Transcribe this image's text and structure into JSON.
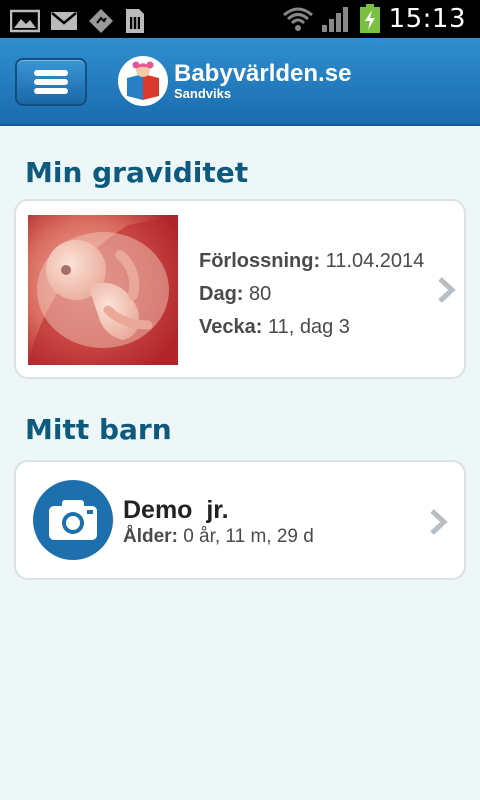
{
  "status_bar": {
    "time": "15:13",
    "icons": [
      "image-icon",
      "mail-icon",
      "usb-debug-icon",
      "sim-card-icon",
      "wifi-icon",
      "signal-icon",
      "battery-charging-icon"
    ]
  },
  "header": {
    "menu_icon": "hamburger-icon",
    "brand_title": "Babyvärlden.se",
    "brand_subtitle": "Sandviks"
  },
  "pregnancy": {
    "section_title": "Min graviditet",
    "labels": {
      "due": "Förlossning:",
      "day": "Dag:",
      "week": "Vecka:"
    },
    "values": {
      "due": "11.04.2014",
      "day": "80",
      "week": "11, dag 3"
    }
  },
  "child": {
    "section_title": "Mitt barn",
    "name": "Demo  jr.",
    "age_label": "Ålder:",
    "age_value": "0 år, 11 m, 29 d",
    "avatar_icon": "camera-icon"
  },
  "colors": {
    "appbar": "#1f7cc0",
    "title": "#0d5a7e",
    "background": "#eef7f8",
    "avatar": "#1d6fae"
  }
}
